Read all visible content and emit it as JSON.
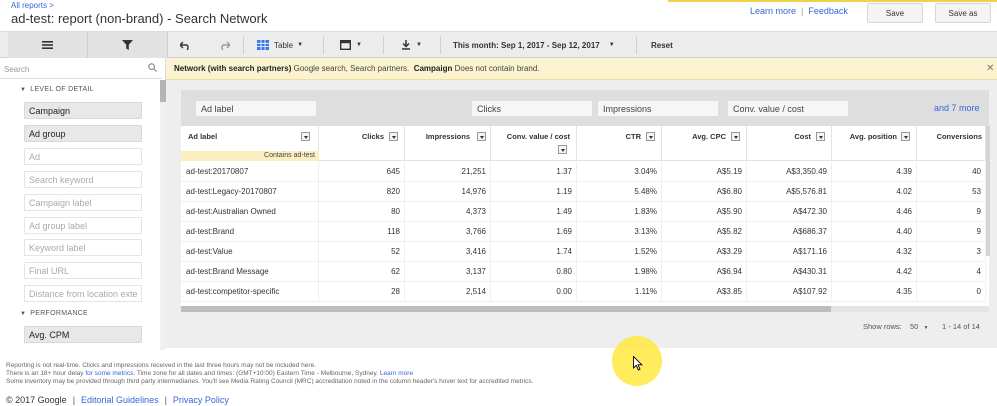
{
  "header": {
    "breadcrumb": "All reports >",
    "title": "ad-test: report (non-brand) - Search Network",
    "learn_more": "Learn more",
    "feedback": "Feedback",
    "save": "Save",
    "save_as": "Save as"
  },
  "toolbar": {
    "table_label": "Table",
    "date_range": "This month: Sep 1, 2017 - Sep 12, 2017",
    "reset": "Reset"
  },
  "sidebar": {
    "search_placeholder": "Search",
    "level_of_detail": "LEVEL OF DETAIL",
    "performance": "PERFORMANCE",
    "items": [
      {
        "label": "Campaign",
        "active": true
      },
      {
        "label": "Ad group",
        "active": true
      },
      {
        "label": "Ad",
        "active": false
      },
      {
        "label": "Search keyword",
        "active": false
      },
      {
        "label": "Campaign label",
        "active": false
      },
      {
        "label": "Ad group label",
        "active": false
      },
      {
        "label": "Keyword label",
        "active": false
      },
      {
        "label": "Final URL",
        "active": false
      },
      {
        "label": "Distance from location exte",
        "active": false
      }
    ],
    "performance_items": [
      {
        "label": "Avg. CPM",
        "active": true
      }
    ]
  },
  "filter_bar": {
    "network_label": "Network (with search partners)",
    "network_value": "Google search, Search partners.",
    "campaign_label": "Campaign",
    "campaign_value": "Does not contain brand."
  },
  "selectors": {
    "row_label": "Ad label",
    "metrics": [
      "Clicks",
      "Impressions",
      "Conv. value / cost"
    ],
    "more": "and 7 more"
  },
  "table": {
    "columns": [
      "Ad label",
      "Clicks",
      "Impressions",
      "Conv. value / cost",
      "CTR",
      "Avg. CPC",
      "Cost",
      "Avg. position",
      "Conversions"
    ],
    "filter_note": "Contains ad-test",
    "rows": [
      [
        "ad-test:20170807",
        "645",
        "21,251",
        "1.37",
        "3.04%",
        "A$5.19",
        "A$3,350.49",
        "4.39",
        "40"
      ],
      [
        "ad-test:Legacy-20170807",
        "820",
        "14,976",
        "1.19",
        "5.48%",
        "A$6.80",
        "A$5,576.81",
        "4.02",
        "53"
      ],
      [
        "ad-test:Australian Owned",
        "80",
        "4,373",
        "1.49",
        "1.83%",
        "A$5.90",
        "A$472.30",
        "4.46",
        "9"
      ],
      [
        "ad-test:Brand",
        "118",
        "3,766",
        "1.69",
        "3.13%",
        "A$5.82",
        "A$686.37",
        "4.40",
        "9"
      ],
      [
        "ad-test:Value",
        "52",
        "3,416",
        "1.74",
        "1.52%",
        "A$3.29",
        "A$171.16",
        "4.32",
        "3"
      ],
      [
        "ad-test:Brand Message",
        "62",
        "3,137",
        "0.80",
        "1.98%",
        "A$6.94",
        "A$430.31",
        "4.42",
        "4"
      ],
      [
        "ad-test:competitor-specific",
        "28",
        "2,514",
        "0.00",
        "1.11%",
        "A$3.85",
        "A$107.92",
        "4.35",
        "0"
      ]
    ]
  },
  "pager": {
    "show_rows_label": "Show rows:",
    "show_rows_value": "50",
    "range": "1 - 14 of 14"
  },
  "notes": {
    "line1": "Reporting is not real-time. Clicks and impressions received in the last three hours may not be included here.",
    "line2_pre": "There is an 18+ hour delay",
    "line2_link": "for some metrics",
    "line2_post": ". Time zone for all dates and times: (GMT+10:00) Eastern Time - Melbourne, Sydney.",
    "line2_link2": "Learn more",
    "line3": "Some inventory may be provided through third party intermediaries. You'll see Media Rating Council (MRC) accreditation noted in the column header's hover text for accredited metrics."
  },
  "footer": {
    "copyright": "© 2017 Google",
    "editorial": "Editorial Guidelines",
    "privacy": "Privacy Policy"
  }
}
